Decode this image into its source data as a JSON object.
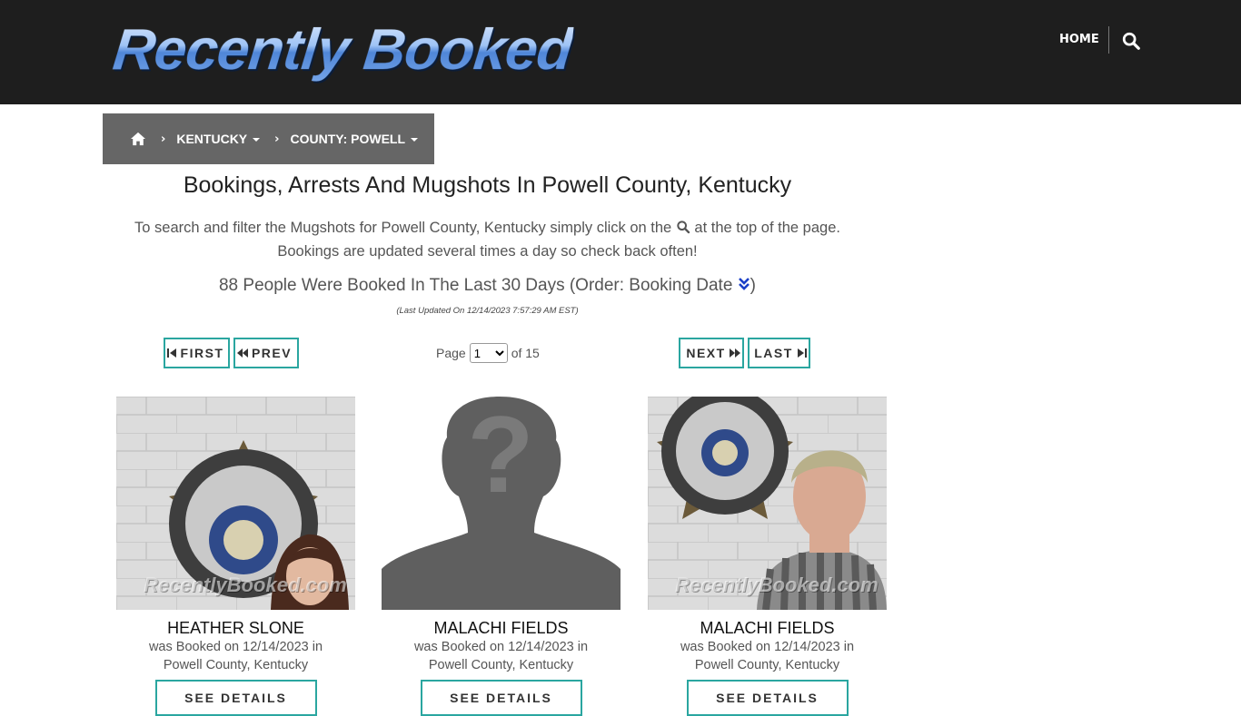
{
  "header": {
    "logo_text": "Recently Booked",
    "nav_home": "HOME",
    "icons": {
      "search": "search-icon"
    }
  },
  "breadcrumb": {
    "home_icon": "home-icon",
    "items": [
      {
        "label": "KENTUCKY"
      },
      {
        "label": "COUNTY: POWELL"
      }
    ]
  },
  "main": {
    "title": "Bookings, Arrests And Mugshots In Powell County, Kentucky",
    "intro_part1": "To search and filter the Mugshots for Powell County, Kentucky simply click on the",
    "intro_part2": "at the top of the page.",
    "intro_line2": "Bookings are updated several times a day so check back often!",
    "count_text": "88 People Were Booked In The Last 30 Days (Order: Booking Date",
    "count_close": ")",
    "last_updated": "(Last Updated On 12/14/2023 7:57:29 AM EST)"
  },
  "pager": {
    "first": "FIRST",
    "prev": "PREV",
    "next": "NEXT",
    "last": "LAST",
    "page_label": "Page",
    "current_page": "1",
    "of_label": "of 15"
  },
  "bookings": [
    {
      "name": "HEATHER SLONE",
      "booked_line": "was Booked on 12/14/2023 in",
      "location": "Powell County, Kentucky",
      "button": "SEE DETAILS",
      "photo": "mugshot-female",
      "watermark": "RecentlyBooked.com"
    },
    {
      "name": "MALACHI FIELDS",
      "booked_line": "was Booked on 12/14/2023 in",
      "location": "Powell County, Kentucky",
      "button": "SEE DETAILS",
      "photo": "no-photo-silhouette"
    },
    {
      "name": "MALACHI FIELDS",
      "booked_line": "was Booked on 12/14/2023 in",
      "location": "Powell County, Kentucky",
      "button": "SEE DETAILS",
      "photo": "mugshot-male",
      "watermark": "RecentlyBooked.com"
    }
  ],
  "colors": {
    "header_bg": "#1e1e1e",
    "breadcrumb_bg": "#666666",
    "accent_teal": "#2aa6a0",
    "order_icon": "#1a3fc8"
  }
}
